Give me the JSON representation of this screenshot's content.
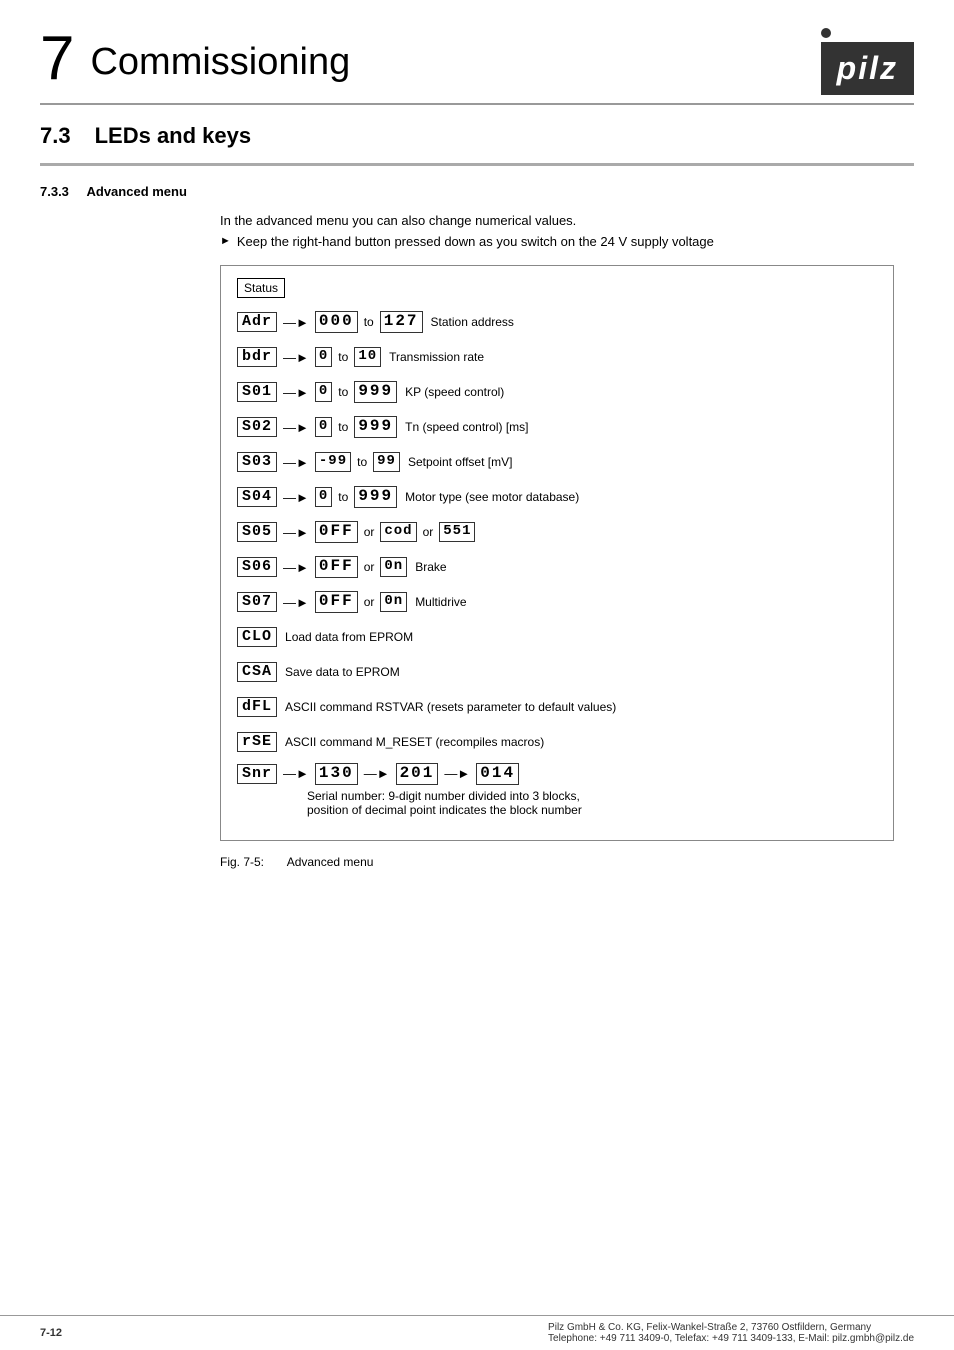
{
  "page": {
    "chapter_number": "7",
    "chapter_title": "Commissioning",
    "logo_text": "pilz",
    "logo_dot": "●"
  },
  "section_73": {
    "number": "7.3",
    "title": "LEDs and keys"
  },
  "section_733": {
    "number": "7.3.3",
    "title": "Advanced menu",
    "intro": "In the advanced menu you can also change numerical values.",
    "bullet": "Keep the right-hand button pressed down as you switch on the 24 V supply voltage"
  },
  "diagram": {
    "status_label": "Status",
    "rows": [
      {
        "left_display": "Adr",
        "arrow": "→",
        "range_from": "000",
        "to": "to",
        "range_to": "127",
        "description": "Station address"
      },
      {
        "left_display": "bdr",
        "arrow": "→",
        "range_from": "0",
        "to": "to",
        "range_to": "10",
        "description": "Transmission rate"
      },
      {
        "left_display": "S01",
        "arrow": "→",
        "range_from": "0",
        "to": "to",
        "range_to": "999",
        "description": "KP (speed control)"
      },
      {
        "left_display": "S02",
        "arrow": "→",
        "range_from": "0",
        "to": "to",
        "range_to": "999",
        "description": "Tn (speed control) [ms]"
      },
      {
        "left_display": "S03",
        "arrow": "→",
        "range_from": "-99",
        "to": "to",
        "range_to": "99",
        "description": "Setpoint offset [mV]"
      },
      {
        "left_display": "S04",
        "arrow": "→",
        "range_from": "0",
        "to": "to",
        "range_to": "999",
        "description": "Motor type (see motor database)"
      },
      {
        "left_display": "S05",
        "arrow": "→",
        "value1": "0FF",
        "or1": "or",
        "value2": "cod",
        "or2": "or",
        "value3": "551",
        "description": ""
      },
      {
        "left_display": "S06",
        "arrow": "→",
        "value1": "0FF",
        "or1": "or",
        "value2": "0n",
        "description": "Brake"
      },
      {
        "left_display": "S07",
        "arrow": "→",
        "value1": "0FF",
        "or1": "or",
        "value2": "0n",
        "description": "Multidrive"
      },
      {
        "left_display": "CLO",
        "description": "Load data from EPROM"
      },
      {
        "left_display": "CSA",
        "description": "Save data to EPROM"
      },
      {
        "left_display": "dFL",
        "description": "ASCII command RSTVAR (resets parameter to default values)"
      },
      {
        "left_display": "rSE",
        "description": "ASCII command M_RESET (recompiles macros)"
      },
      {
        "left_display": "Snr",
        "arrow": "→",
        "block1": "130",
        "arrow2": "→",
        "block2": "201",
        "arrow3": "→",
        "block3": "014",
        "description": "Serial number: 9-digit number divided into 3 blocks,\nposition of decimal point indicates the block number"
      }
    ]
  },
  "figure_caption": {
    "label": "Fig. 7-5:",
    "text": "Advanced menu"
  },
  "footer": {
    "company": "Pilz GmbH & Co. KG, Felix-Wankel-Straße 2, 73760 Ostfildern, Germany",
    "phone": "Telephone: +49 711 3409-0, Telefax: +49 711 3409-133, E-Mail: pilz.gmbh@pilz.de",
    "page_number": "7-12"
  }
}
